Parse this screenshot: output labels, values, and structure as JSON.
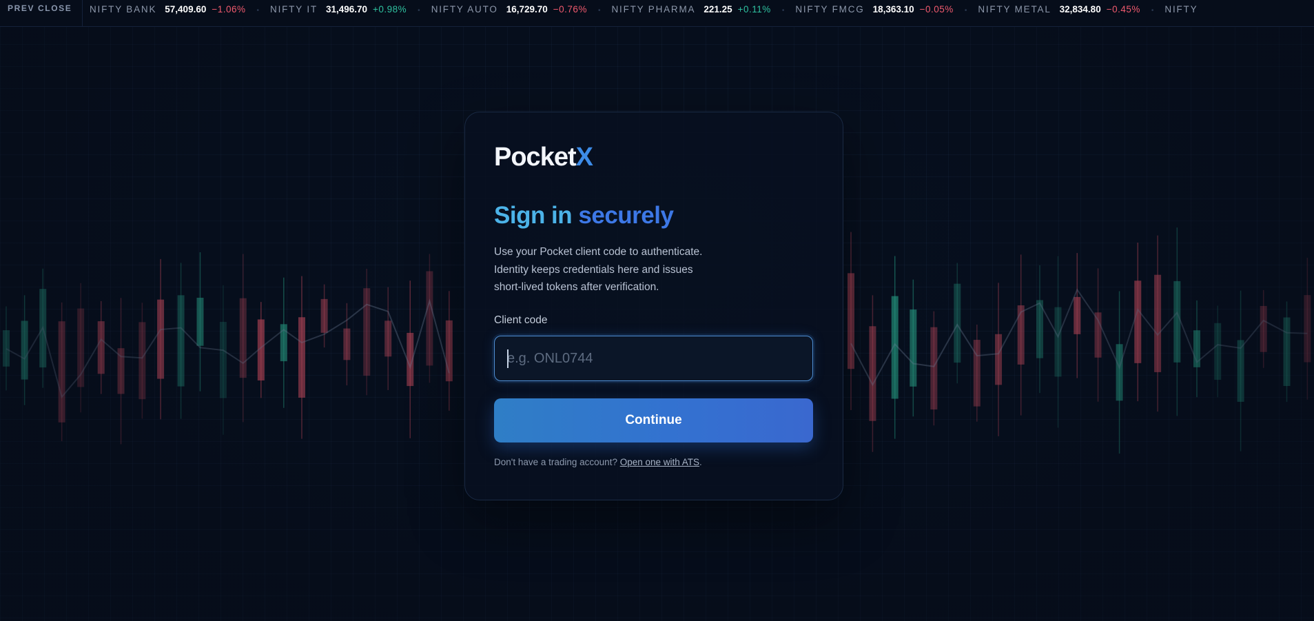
{
  "ticker": {
    "label": "PREV CLOSE",
    "items": [
      {
        "name": "NIFTY BANK",
        "value": "57,409.60",
        "change": "−1.06%",
        "direction": "down"
      },
      {
        "name": "NIFTY IT",
        "value": "31,496.70",
        "change": "+0.98%",
        "direction": "up"
      },
      {
        "name": "NIFTY AUTO",
        "value": "16,729.70",
        "change": "−0.76%",
        "direction": "down"
      },
      {
        "name": "NIFTY PHARMA",
        "value": "221.25",
        "change": "+0.11%",
        "direction": "up"
      },
      {
        "name": "NIFTY FMCG",
        "value": "18,363.10",
        "change": "−0.05%",
        "direction": "down"
      },
      {
        "name": "NIFTY METAL",
        "value": "32,834.80",
        "change": "−0.45%",
        "direction": "down"
      },
      {
        "name": "NIFTY",
        "value": "",
        "change": "",
        "direction": "up"
      }
    ]
  },
  "card": {
    "logo": {
      "main": "Pocket",
      "accent": "X"
    },
    "title": {
      "part1": "Sign in",
      "part2": "securely"
    },
    "description": [
      "Use your Pocket client code to authenticate.",
      "Identity keeps credentials here and issues",
      "short-lived tokens after verification."
    ],
    "field_label": "Client code",
    "input": {
      "placeholder": "e.g. ONL0744",
      "value": ""
    },
    "button_label": "Continue",
    "footer": {
      "text": "Don't have a trading account?",
      "link": "Open one with ATS",
      "suffix": "."
    }
  },
  "colors": {
    "background": "#081225",
    "accent_blue": "#3d78e6",
    "accent_cyan": "#4cb3e8",
    "up": "#2fc2a0",
    "down": "#f05a6e"
  }
}
